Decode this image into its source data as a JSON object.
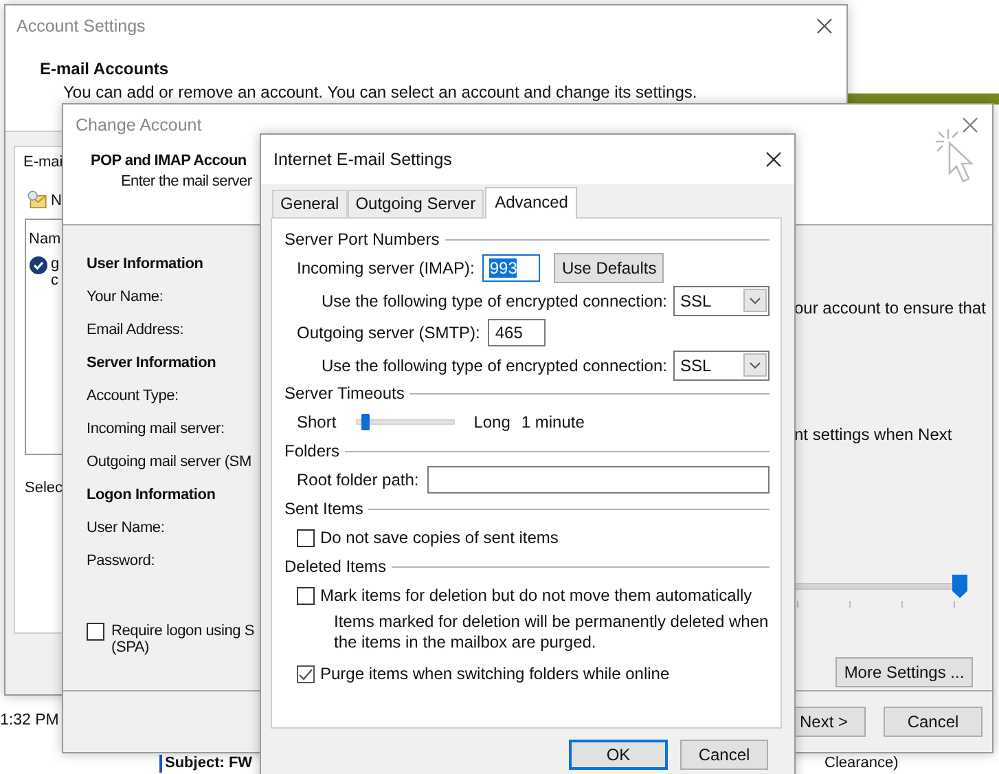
{
  "desktop": {
    "clock": "1:32 PM",
    "preview_subject": "Subject: FW",
    "preview_tail": "Clearance)"
  },
  "account_settings": {
    "title": "Account Settings",
    "heading": "E-mail Accounts",
    "description": "You can add or remove an account. You can select an account and change its settings.",
    "tab_label": "E-mai",
    "new_label": "N",
    "list_header": "Nam",
    "account_lines": [
      "g",
      "c"
    ],
    "select_label": "Selec"
  },
  "change_account": {
    "title": "Change Account",
    "heading": "POP and IMAP Accoun",
    "subheading": "Enter the mail server",
    "sections": [
      {
        "title": "User Information",
        "fields": [
          "Your Name:",
          "Email Address:"
        ]
      },
      {
        "title": "Server Information",
        "fields": [
          "Account Type:",
          "Incoming mail server:",
          "Outgoing mail server (SM"
        ]
      },
      {
        "title": "Logon Information",
        "fields": [
          "User Name:",
          "Password:"
        ]
      }
    ],
    "spa": {
      "checked": false,
      "lines": [
        "Require logon using S",
        "(SPA)"
      ]
    },
    "right_texts": [
      "our account to ensure that",
      "nt settings when Next"
    ],
    "slider": {
      "level": 1
    },
    "more_settings": "More Settings ...",
    "next": "Next >",
    "cancel": "Cancel"
  },
  "internet_settings": {
    "title": "Internet E-mail Settings",
    "tabs": [
      {
        "label": "General",
        "selected": false
      },
      {
        "label": "Outgoing Server",
        "selected": false
      },
      {
        "label": "Advanced",
        "selected": true
      }
    ],
    "ports": {
      "title": "Server Port Numbers",
      "incoming_label": "Incoming server (IMAP):",
      "incoming_value": "993",
      "incoming_highlighted": true,
      "use_defaults": "Use Defaults",
      "incoming_encryption_label": "Use the following type of encrypted connection:",
      "incoming_encryption": "SSL",
      "outgoing_label": "Outgoing server (SMTP):",
      "outgoing_value": "465",
      "outgoing_encryption_label": "Use the following type of encrypted connection:",
      "outgoing_encryption": "SSL"
    },
    "timeouts": {
      "title": "Server Timeouts",
      "short": "Short",
      "long": "Long",
      "level": 0.1,
      "reading": "1 minute"
    },
    "folders": {
      "title": "Folders",
      "root_label": "Root folder path:"
    },
    "sent_items": {
      "title": "Sent Items",
      "options": [
        {
          "kind": "checkbox",
          "label": "Do not save copies of sent items",
          "checked": false
        }
      ]
    },
    "deleted_items": {
      "title": "Deleted Items",
      "options": [
        {
          "kind": "checkbox",
          "label": "Mark items for deletion but do not move them automatically",
          "checked": false
        },
        {
          "kind": "note",
          "label": "Items marked for deletion will be permanently deleted when the items in the mailbox are purged."
        },
        {
          "kind": "checkbox",
          "label": "Purge items when switching folders while online",
          "checked": true
        }
      ]
    },
    "ok": "OK",
    "cancel": "Cancel"
  }
}
